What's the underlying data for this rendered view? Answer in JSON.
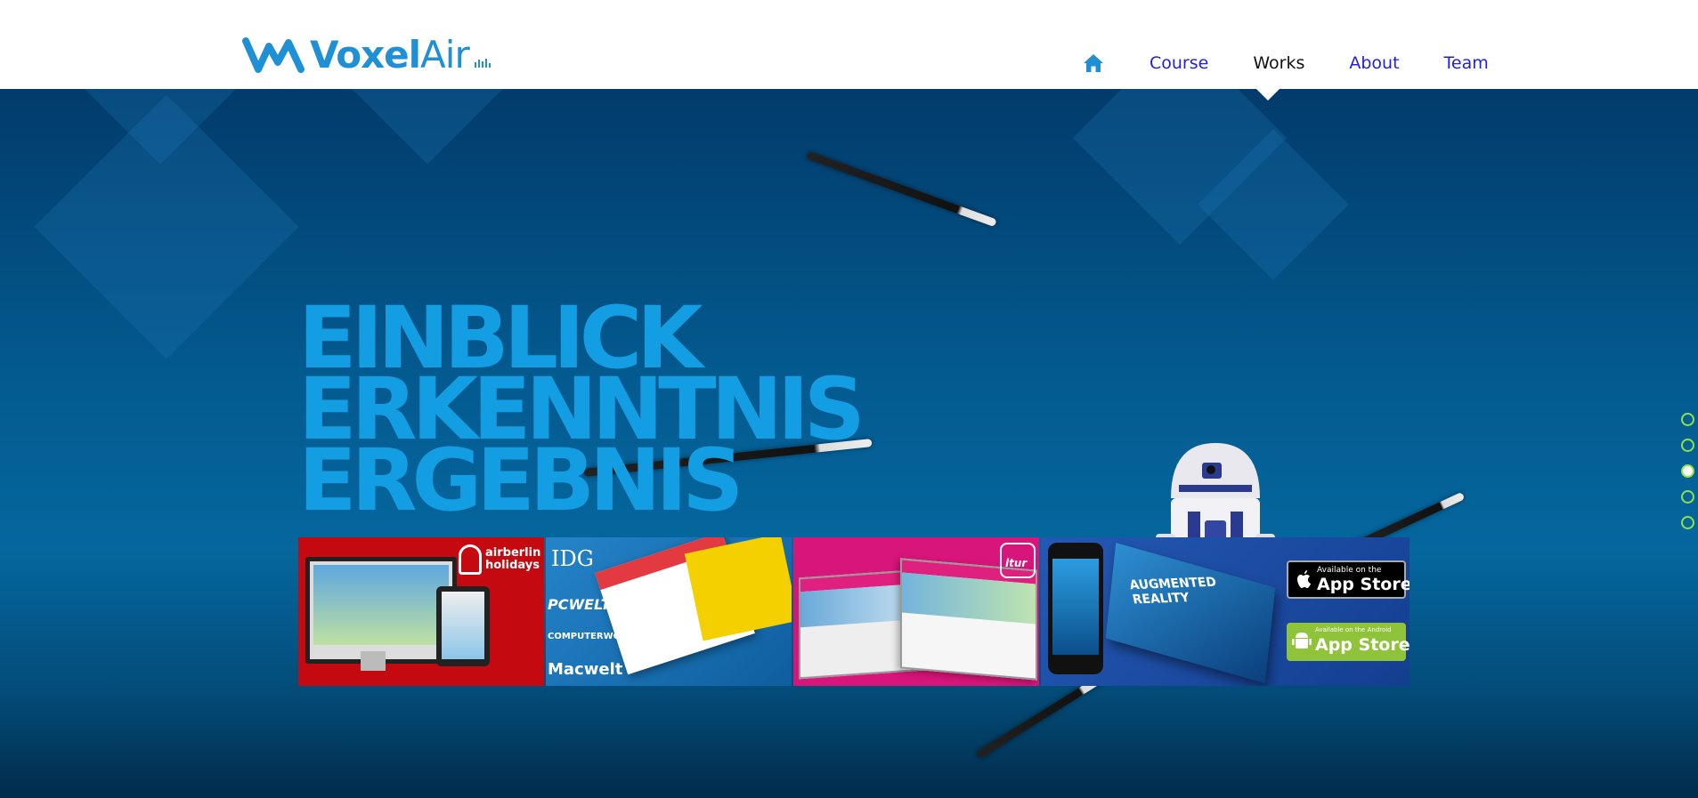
{
  "brand": {
    "name_prefix": "Voxel",
    "name_suffix": "Air",
    "accent_color": "#1f8fd6"
  },
  "nav": {
    "home_icon": "home-icon",
    "items": [
      {
        "label": "Course",
        "active": false
      },
      {
        "label": "Works",
        "active": true
      },
      {
        "label": "About",
        "active": false
      },
      {
        "label": "Team",
        "active": false
      }
    ],
    "link_color": "#1f1fe0",
    "active_color": "#111111"
  },
  "hero": {
    "headline": [
      "EINBLICK",
      "ERKENNTNIS",
      "ERGEBNIS"
    ],
    "headline_color": "#139ee3"
  },
  "works": {
    "tiles": [
      {
        "name": "airberlin",
        "brand_text": "airberlin holidays",
        "bg": "#c40a10"
      },
      {
        "name": "idg",
        "brand_text": "IDG",
        "sub_brands": [
          "PCWELT",
          "COMPUTERWOCHE",
          "Macwelt"
        ],
        "bg": "#1d7fc8"
      },
      {
        "name": "ltur",
        "brand_text": "ltur",
        "bg": "#d8157a"
      },
      {
        "name": "augmented-reality",
        "brand_text": "AUGMENTED REALITY",
        "badges": [
          {
            "small": "Available on the",
            "big": "App Store"
          },
          {
            "small": "Available on the Android",
            "big": "App Store"
          }
        ],
        "bg": "#1a4fa8"
      }
    ]
  },
  "pager": {
    "count": 5,
    "active_index": 2,
    "color": "#8ee24a"
  }
}
